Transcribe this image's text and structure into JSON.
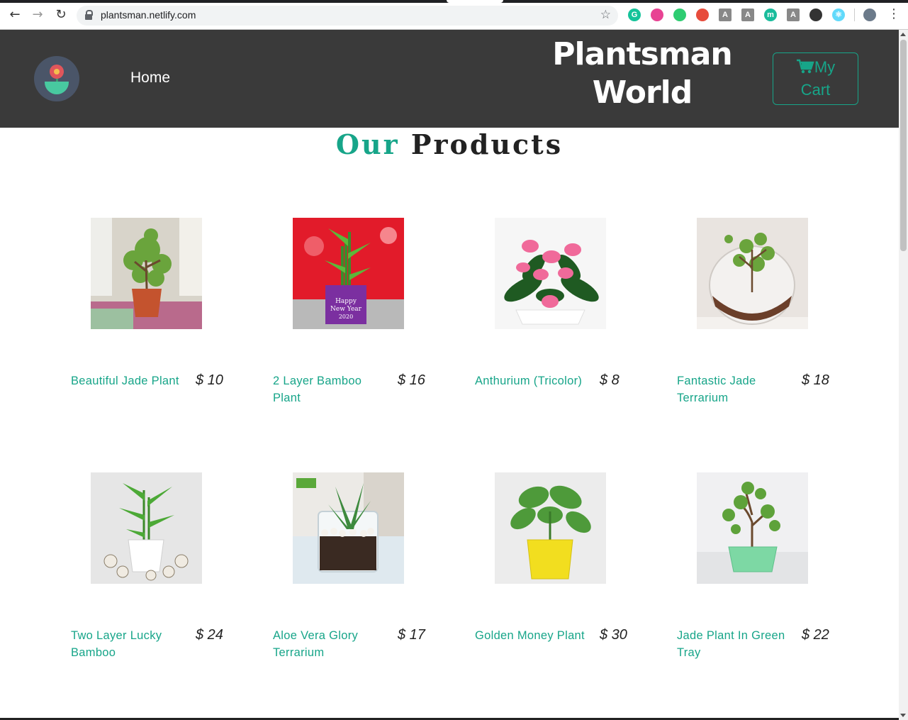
{
  "browser": {
    "url": "plantsman.netlify.com",
    "extensions": [
      {
        "name": "grammarly-icon",
        "letter": "G",
        "color": "#15c39a"
      },
      {
        "name": "colorpick-icon",
        "letter": "",
        "color": "#e84393"
      },
      {
        "name": "octotree-icon",
        "letter": "",
        "color": "#2ecc71"
      },
      {
        "name": "rss-icon",
        "letter": "",
        "color": "#e74c3c"
      },
      {
        "name": "font-a-icon",
        "letter": "A",
        "color": "#888888"
      },
      {
        "name": "font-a-icon-2",
        "letter": "A",
        "color": "#888888"
      },
      {
        "name": "m-icon",
        "letter": "m",
        "color": "#1abc9c"
      },
      {
        "name": "font-a-icon-3",
        "letter": "A",
        "color": "#888888"
      },
      {
        "name": "circle-icon",
        "letter": "",
        "color": "#333333"
      },
      {
        "name": "react-devtools-icon",
        "letter": "⚛",
        "color": "#61dafb"
      }
    ]
  },
  "header": {
    "nav_home": "Home",
    "brand_line1": "Plantsman",
    "brand_line2": "World",
    "cart_line1": "My",
    "cart_line2": "Cart"
  },
  "section": {
    "title_word1": "Our",
    "title_word2": "Products"
  },
  "colors": {
    "accent": "#17a589",
    "header_bg": "#3a3a3a"
  },
  "products": [
    {
      "name": "Beautiful Jade Plant",
      "price": "$ 10",
      "image": "jade-plant-in-pot"
    },
    {
      "name": "2 Layer Bamboo Plant",
      "price": "$ 16",
      "image": "bamboo-happy-new-year"
    },
    {
      "name": "Anthurium (Tricolor)",
      "price": "$ 8",
      "image": "pink-anthurium"
    },
    {
      "name": "Fantastic Jade Terrarium",
      "price": "$ 18",
      "image": "jade-terrarium-glass"
    },
    {
      "name": "Two Layer Lucky Bamboo",
      "price": "$ 24",
      "image": "lucky-bamboo-white-pot"
    },
    {
      "name": "Aloe Vera Glory Terrarium",
      "price": "$ 17",
      "image": "aloe-vera-glass"
    },
    {
      "name": "Golden Money Plant",
      "price": "$ 30",
      "image": "money-plant-yellow-pot"
    },
    {
      "name": "Jade Plant In Green Tray",
      "price": "$ 22",
      "image": "jade-bonsai-green-tray"
    }
  ]
}
